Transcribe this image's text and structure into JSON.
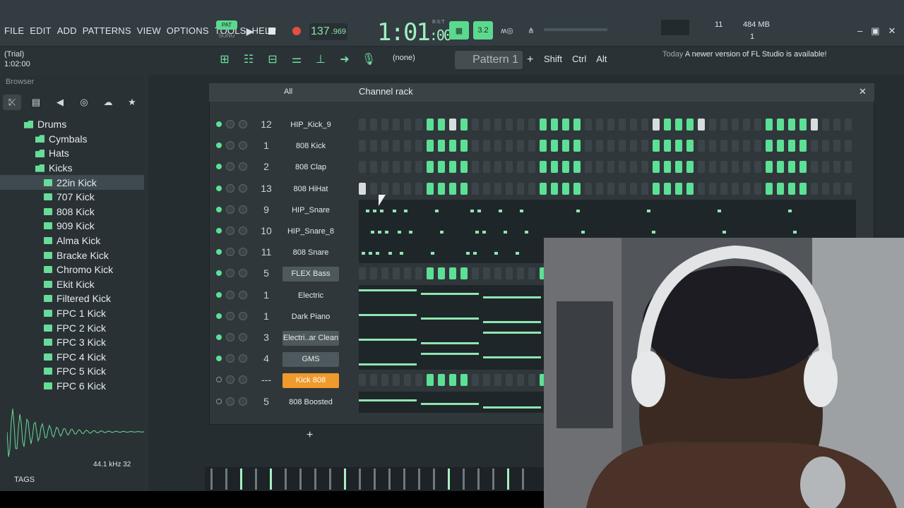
{
  "menu": [
    "FILE",
    "EDIT",
    "ADD",
    "PATTERNS",
    "VIEW",
    "OPTIONS",
    "TOOLS",
    "HELP"
  ],
  "transport": {
    "pat": "PAT",
    "song": "SONG",
    "tempo": "137",
    "tempo_frac": ".969",
    "time": "1:01",
    "time_sub": ":00",
    "bst": "B:S:T"
  },
  "modes": [
    "▦",
    "3.2",
    "ʍ◎",
    "⋔"
  ],
  "status": {
    "cpu": "11",
    "ram": "484 MB",
    "poly": "1"
  },
  "trial": {
    "label": "(Trial)",
    "time": "1:02:00"
  },
  "toolbar": {
    "pattern_none": "(none)",
    "pattern": "Pattern 1",
    "plus": "+",
    "keys": [
      "Shift",
      "Ctrl",
      "Alt"
    ]
  },
  "news": {
    "today": "Today",
    "text": "A newer version of FL Studio is available!"
  },
  "browser": {
    "title": "Browser",
    "tabs": [
      "⤪",
      "▤",
      "◀",
      "◎",
      "☁",
      "★"
    ]
  },
  "tree": [
    {
      "label": "Drums",
      "level": 1,
      "type": "folder"
    },
    {
      "label": "Cymbals",
      "level": 2,
      "type": "folder"
    },
    {
      "label": "Hats",
      "level": 2,
      "type": "folder"
    },
    {
      "label": "Kicks",
      "level": 2,
      "type": "folder"
    },
    {
      "label": "22in Kick",
      "level": 3,
      "type": "file",
      "selected": true
    },
    {
      "label": "707 Kick",
      "level": 3,
      "type": "file"
    },
    {
      "label": "808 Kick",
      "level": 3,
      "type": "file"
    },
    {
      "label": "909 Kick",
      "level": 3,
      "type": "file"
    },
    {
      "label": "Alma Kick",
      "level": 3,
      "type": "file"
    },
    {
      "label": "Bracke Kick",
      "level": 3,
      "type": "file"
    },
    {
      "label": "Chromo Kick",
      "level": 3,
      "type": "file"
    },
    {
      "label": "Ekit Kick",
      "level": 3,
      "type": "file"
    },
    {
      "label": "Filtered Kick",
      "level": 3,
      "type": "file"
    },
    {
      "label": "FPC 1 Kick",
      "level": 3,
      "type": "file"
    },
    {
      "label": "FPC 2 Kick",
      "level": 3,
      "type": "file"
    },
    {
      "label": "FPC 3 Kick",
      "level": 3,
      "type": "file"
    },
    {
      "label": "FPC 4 Kick",
      "level": 3,
      "type": "file"
    },
    {
      "label": "FPC 5 Kick",
      "level": 3,
      "type": "file"
    },
    {
      "label": "FPC 6 Kick",
      "level": 3,
      "type": "file"
    }
  ],
  "sample": {
    "rate": "44.1 kHz 32"
  },
  "tags": "TAGS",
  "channel_rack": {
    "filter": "All",
    "title": "Channel rack",
    "channels": [
      {
        "num": "12",
        "name": "HIP_Kick_9",
        "style": "plain",
        "led": true,
        "mode": "steps",
        "steps": [
          0,
          0,
          0,
          0,
          0,
          0,
          1,
          1,
          2,
          1,
          0,
          0,
          0,
          0,
          0,
          0,
          1,
          1,
          1,
          1,
          0,
          0,
          0,
          0,
          0,
          0,
          2,
          1,
          1,
          1,
          2,
          0,
          0,
          0,
          0,
          0,
          1,
          1,
          1,
          1,
          2,
          0,
          0,
          0,
          0,
          0,
          2,
          1,
          1,
          1,
          1,
          0,
          0,
          0,
          0,
          0
        ],
        "white": [
          0,
          8,
          26,
          30,
          40,
          46
        ]
      },
      {
        "num": "1",
        "name": "808 Kick",
        "style": "plain",
        "led": true,
        "mode": "steps",
        "steps": [
          0,
          0,
          0,
          0,
          0,
          0,
          1,
          1,
          1,
          1,
          0,
          0,
          0,
          0,
          0,
          0,
          1,
          1,
          1,
          1,
          0,
          0,
          0,
          0,
          0,
          0,
          1,
          1,
          1,
          1,
          0,
          0,
          0,
          0,
          0,
          0,
          1,
          1,
          1,
          1,
          0,
          0,
          0,
          0,
          0,
          0,
          1,
          1,
          1,
          1,
          0,
          0,
          0,
          0,
          0,
          0
        ]
      },
      {
        "num": "2",
        "name": "808 Clap",
        "style": "plain",
        "led": true,
        "mode": "steps",
        "steps": [
          0,
          0,
          0,
          0,
          0,
          0,
          1,
          1,
          1,
          1,
          0,
          0,
          0,
          0,
          0,
          0,
          1,
          1,
          1,
          1,
          0,
          0,
          0,
          0,
          0,
          0,
          1,
          1,
          1,
          1,
          0,
          0,
          0,
          0,
          0,
          0,
          1,
          1,
          1,
          1,
          0,
          0,
          0,
          0,
          0,
          0,
          1,
          1,
          1,
          1,
          0,
          0,
          0,
          0,
          0,
          0
        ]
      },
      {
        "num": "13",
        "name": "808 HiHat",
        "style": "plain",
        "led": true,
        "mode": "steps",
        "steps": [
          2,
          0,
          0,
          0,
          0,
          0,
          1,
          1,
          1,
          1,
          0,
          0,
          0,
          0,
          0,
          0,
          1,
          1,
          1,
          1,
          0,
          0,
          0,
          0,
          0,
          0,
          1,
          1,
          1,
          1,
          0,
          0,
          0,
          0,
          0,
          0,
          1,
          1,
          1,
          1,
          0,
          0,
          0,
          0,
          0,
          0,
          1,
          1,
          1,
          1,
          0,
          0,
          0,
          0,
          0,
          0
        ]
      },
      {
        "num": "9",
        "name": "HIP_Snare",
        "style": "plain",
        "led": true,
        "mode": "dots"
      },
      {
        "num": "10",
        "name": "HIP_Snare_8",
        "style": "plain",
        "led": true,
        "mode": "dots"
      },
      {
        "num": "11",
        "name": "808 Snare",
        "style": "plain",
        "led": true,
        "mode": "dots"
      },
      {
        "num": "5",
        "name": "FLEX Bass",
        "style": "grey",
        "led": true,
        "mode": "steps",
        "steps": [
          0,
          0,
          0,
          0,
          0,
          0,
          1,
          1,
          1,
          1,
          0,
          0,
          0,
          0,
          0,
          0,
          1,
          1,
          1,
          1,
          0,
          0,
          0,
          0
        ]
      },
      {
        "num": "1",
        "name": "Electric",
        "style": "plain",
        "led": true,
        "mode": "roll"
      },
      {
        "num": "1",
        "name": "Dark Piano",
        "style": "plain",
        "led": true,
        "mode": "roll"
      },
      {
        "num": "3",
        "name": "Electri..ar Clean",
        "style": "grey",
        "led": true,
        "mode": "roll"
      },
      {
        "num": "4",
        "name": "GMS",
        "style": "grey",
        "led": true,
        "mode": "roll"
      },
      {
        "num": "---",
        "name": "Kick 808",
        "style": "orange",
        "led": false,
        "mode": "steps",
        "steps": [
          0,
          0,
          0,
          0,
          0,
          0,
          1,
          1,
          1,
          1,
          0,
          0,
          0,
          0,
          0,
          0,
          1,
          1,
          1,
          1,
          0,
          0,
          0,
          0
        ]
      },
      {
        "num": "5",
        "name": "808 Boosted",
        "style": "plain",
        "led": false,
        "mode": "roll"
      }
    ],
    "add": "+"
  },
  "colors": {
    "accent": "#5ce095",
    "orange": "#ef9a2c",
    "bg": "#2b3236"
  }
}
